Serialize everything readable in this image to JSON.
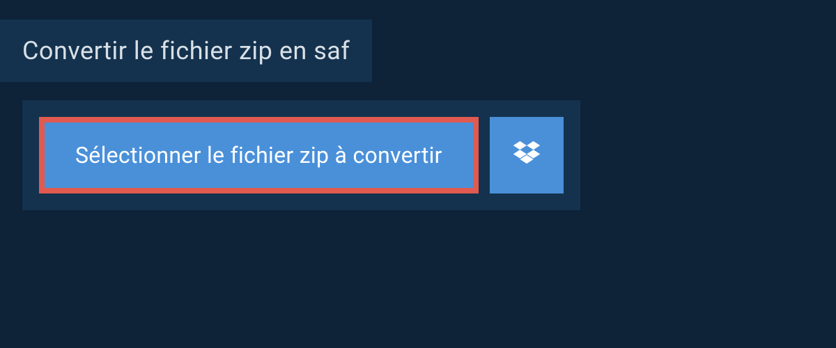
{
  "header": {
    "title": "Convertir le fichier zip en saf"
  },
  "actions": {
    "select_label": "Sélectionner le fichier zip à convertir"
  },
  "colors": {
    "background": "#0e2238",
    "panel": "#14324e",
    "button": "#4a90d9",
    "highlight_border": "#e05a4f",
    "text_light": "#d9e0e6",
    "text_white": "#ffffff"
  }
}
